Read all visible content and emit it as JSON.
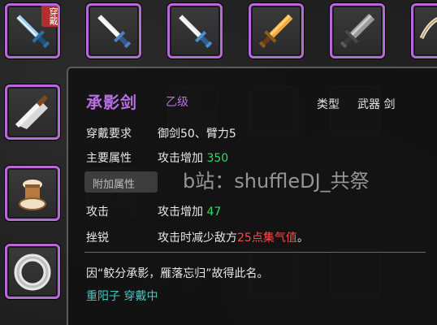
{
  "inventory": {
    "slots": [
      {
        "icon": "blue-sword-icon",
        "equipped": true
      },
      {
        "icon": "white-sword-icon",
        "equipped": false
      },
      {
        "icon": "white-sword-icon",
        "equipped": false
      },
      {
        "icon": "golden-sword-icon",
        "equipped": false
      },
      {
        "icon": "iron-sword-icon",
        "equipped": false
      },
      {
        "icon": "curved-blade-icon",
        "equipped": false
      },
      {
        "icon": "cleaver-icon",
        "equipped": false
      },
      {
        "icon": "drum-icon",
        "equipped": false
      },
      {
        "icon": "ring-icon",
        "equipped": false
      }
    ],
    "wear_badge": "穿戴",
    "rarity_color": "#b768d9"
  },
  "tooltip": {
    "name": "承影剑",
    "grade": "乙级",
    "type_label": "类型",
    "type_value": "武器 剑",
    "requirement_label": "穿戴要求",
    "requirement_value": "御剑50、臂力5",
    "main_attr_label": "主要属性",
    "main_attr_text": "攻击增加 ",
    "main_attr_value": "350",
    "extra_attr_label": "附加属性",
    "attack_label": "攻击",
    "attack_text": "攻击增加 ",
    "attack_value": "47",
    "skill_label": "挫锐",
    "skill_text_before": "攻击时减少敌方",
    "skill_highlight": "25点集气值",
    "skill_text_after": "。",
    "description": "因“鲛分承影，雁落忘归”故得此名。",
    "wearer": "重阳子 穿戴中",
    "name_color": "#b86fe4",
    "value_color": "#37d86a",
    "highlight_color": "#ff4a4a",
    "wearer_color": "#43c9c0"
  },
  "watermark": "b站：shuffleDJ_共祭"
}
